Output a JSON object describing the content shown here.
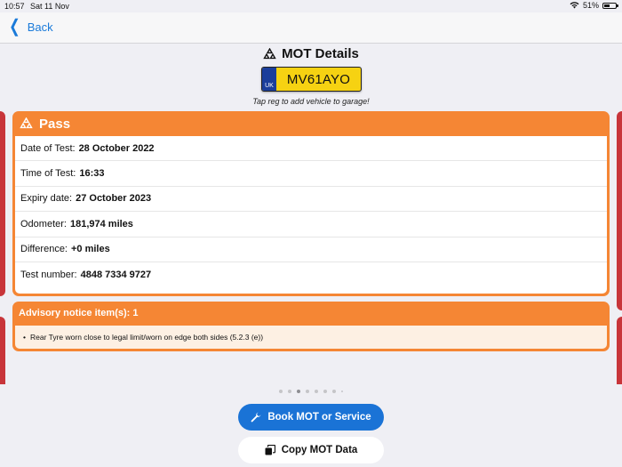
{
  "status_bar": {
    "time": "10:57",
    "date": "Sat 11 Nov",
    "battery": "51%",
    "battery_level": 0.51
  },
  "nav": {
    "back_label": "Back"
  },
  "header": {
    "title": "MOT Details"
  },
  "plate": {
    "country": "UK",
    "registration": "MV61AYO",
    "hint": "Tap reg to add vehicle to garage!"
  },
  "result": {
    "status": "Pass",
    "rows": [
      {
        "label": "Date of Test:",
        "value": "28 October 2022"
      },
      {
        "label": "Time of Test:",
        "value": "16:33"
      },
      {
        "label": "Expiry date:",
        "value": "27 October 2023"
      },
      {
        "label": "Odometer:",
        "value": "181,974 miles"
      },
      {
        "label": "Difference:",
        "value": "+0 miles"
      },
      {
        "label": "Test number:",
        "value": "4848 7334 9727"
      }
    ]
  },
  "advisory": {
    "title": "Advisory notice item(s): 1",
    "items": [
      "Rear Tyre worn close to legal limit/worn on edge  both sides (5.2.3 (e))"
    ]
  },
  "pager": {
    "count": 8,
    "current": 3
  },
  "buttons": {
    "book": "Book MOT or Service",
    "copy": "Copy MOT Data"
  },
  "colors": {
    "accent": "#f58634",
    "link": "#1a7ad9",
    "primary_button": "#1a73d6",
    "side_card": "#c8353a",
    "plate_yellow": "#f6d212",
    "plate_blue": "#1b3e9b"
  },
  "icons": {
    "mot": "mot-triangle-icon",
    "wifi": "wifi-icon",
    "battery": "battery-icon",
    "wrench": "wrench-icon",
    "copy": "copy-icon",
    "back": "chevron-left-icon"
  }
}
